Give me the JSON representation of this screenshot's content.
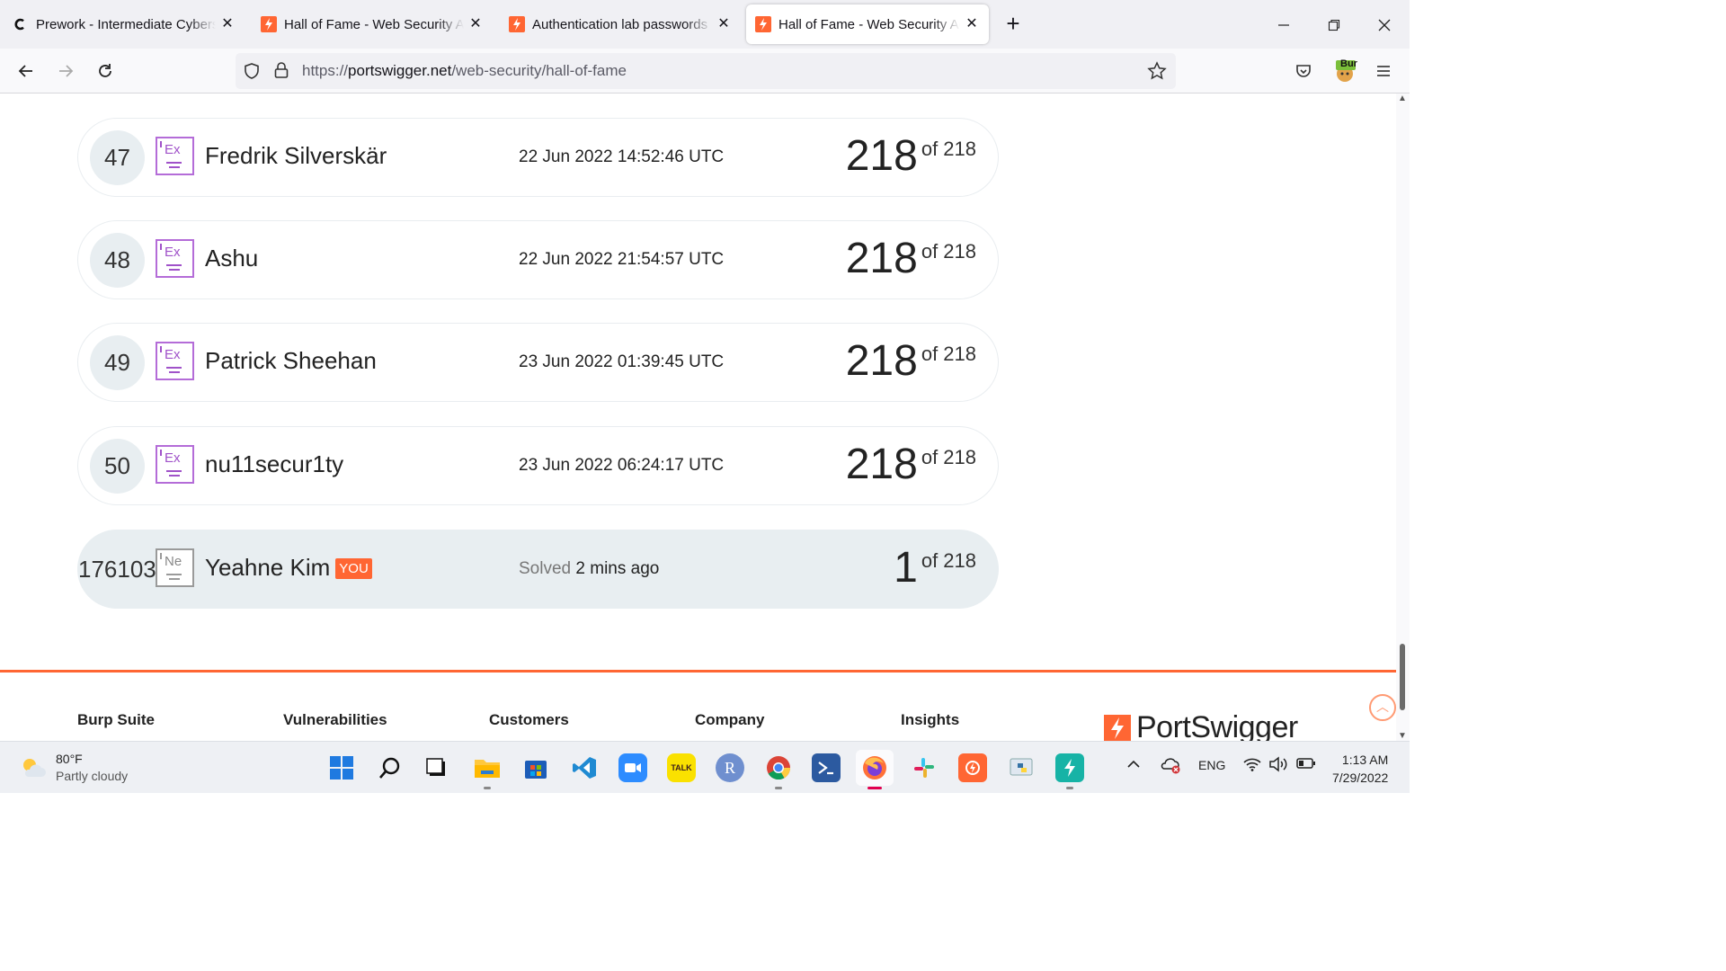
{
  "browser": {
    "tabs": [
      {
        "title": "Prework - Intermediate Cyberse",
        "icon": "codepath-icon",
        "active": false
      },
      {
        "title": "Hall of Fame - Web Security Aca",
        "icon": "portswigger-icon",
        "active": false
      },
      {
        "title": "Authentication lab passwords | W",
        "icon": "portswigger-icon",
        "active": false
      },
      {
        "title": "Hall of Fame - Web Security Aca",
        "icon": "portswigger-icon",
        "active": true
      }
    ],
    "new_tab": "+",
    "close_glyph": "✕",
    "url": {
      "scheme": "https://",
      "host": "portswigger.net",
      "path": "/web-security/hall-of-fame"
    },
    "extension_label": "Bur"
  },
  "leaderboard": {
    "rows": [
      {
        "rank": "47",
        "level": "Ex",
        "name": "Fredrik Silverskär",
        "date": "22 Jun 2022 14:52:46 UTC",
        "score": "218",
        "of": "of 218"
      },
      {
        "rank": "48",
        "level": "Ex",
        "name": "Ashu",
        "date": "22 Jun 2022 21:54:57 UTC",
        "score": "218",
        "of": "of 218"
      },
      {
        "rank": "49",
        "level": "Ex",
        "name": "Patrick Sheehan",
        "date": "23 Jun 2022 01:39:45 UTC",
        "score": "218",
        "of": "of 218"
      },
      {
        "rank": "50",
        "level": "Ex",
        "name": "nu11secur1ty",
        "date": "23 Jun 2022 06:24:17 UTC",
        "score": "218",
        "of": "of 218"
      }
    ],
    "me": {
      "rank": "176103",
      "level": "Ne",
      "name": "Yeahne Kim",
      "badge": "YOU",
      "solved_label": "Solved",
      "solved_time": "2 mins ago",
      "score": "1",
      "of": "of 218"
    }
  },
  "footer": {
    "columns": [
      "Burp Suite",
      "Vulnerabilities",
      "Customers",
      "Company",
      "Insights"
    ],
    "brand": "PortSwigger",
    "accent_color": "#ff6633"
  },
  "taskbar": {
    "weather": {
      "temp": "80°F",
      "condition": "Partly cloudy"
    },
    "language": "ENG",
    "time": "1:13 AM",
    "date": "7/29/2022"
  }
}
